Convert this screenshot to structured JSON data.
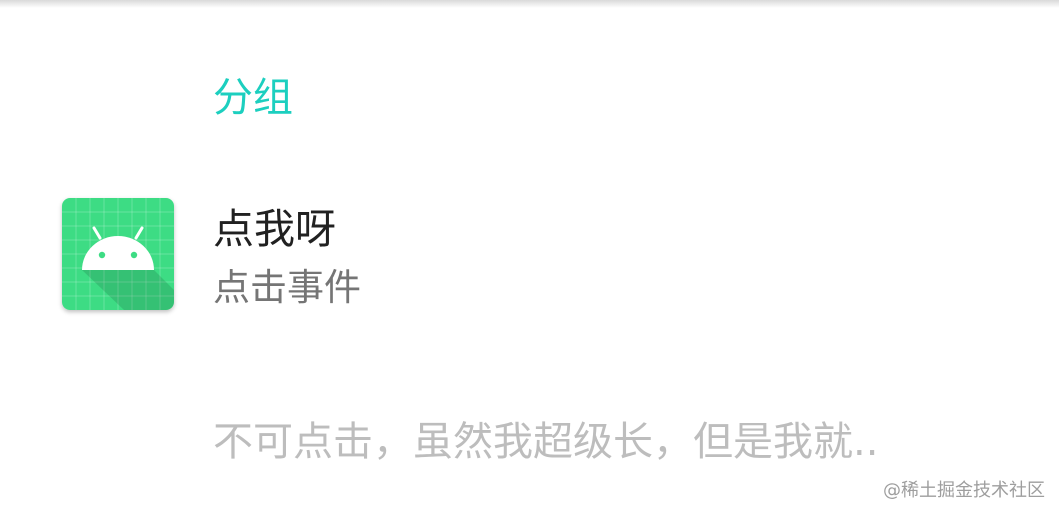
{
  "preference_category": {
    "title": "分组",
    "color": "#1ccfbf"
  },
  "preference_item": {
    "icon": "android-launcher-icon",
    "title": "点我呀",
    "summary": "点击事件"
  },
  "disabled_preference": {
    "title": "不可点击，虽然我超级长，但是我就.."
  },
  "watermark": "@稀土掘金技术社区",
  "colors": {
    "icon_background": "#3ddc84",
    "icon_robot": "#ffffff",
    "title_text": "#212121",
    "summary_text": "#757575",
    "disabled_text": "#bdbdbd"
  }
}
